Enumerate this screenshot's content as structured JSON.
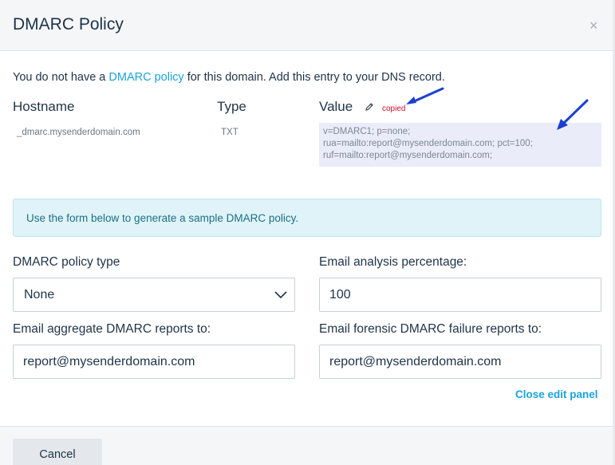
{
  "modal": {
    "title": "DMARC Policy",
    "close_glyph": "×"
  },
  "intro": {
    "before": "You do not have a ",
    "link": "DMARC policy",
    "after": " for this domain. Add this entry to your DNS record."
  },
  "record_table": {
    "headers": {
      "hostname": "Hostname",
      "type": "Type",
      "value": "Value"
    },
    "copied_label": "copied",
    "row": {
      "hostname": "_dmarc.mysenderdomain.com",
      "type": "TXT",
      "value_lines": [
        "v=DMARC1; p=none;",
        "rua=mailto:report@mysenderdomain.com; pct=100;",
        "ruf=mailto:report@mysenderdomain.com;"
      ]
    }
  },
  "info_banner": "Use the form below to generate a sample DMARC policy.",
  "form": {
    "policy_type": {
      "label": "DMARC policy type",
      "value": "None"
    },
    "percentage": {
      "label": "Email analysis percentage:",
      "value": "100"
    },
    "aggregate": {
      "label": "Email aggregate DMARC reports to:",
      "value": "report@mysenderdomain.com"
    },
    "forensic": {
      "label": "Email forensic DMARC failure reports to:",
      "value": "report@mysenderdomain.com"
    },
    "close_panel": "Close edit panel"
  },
  "footer": {
    "cancel_label": "Cancel"
  },
  "colors": {
    "accent": "#1aa3dc",
    "annotation_arrow": "#1d3fd1",
    "copied": "#c8102e",
    "value_bg": "#ebecfa"
  },
  "icons": {
    "edit": "pencil-icon",
    "select": "chevron-down-icon",
    "close": "close-icon"
  }
}
